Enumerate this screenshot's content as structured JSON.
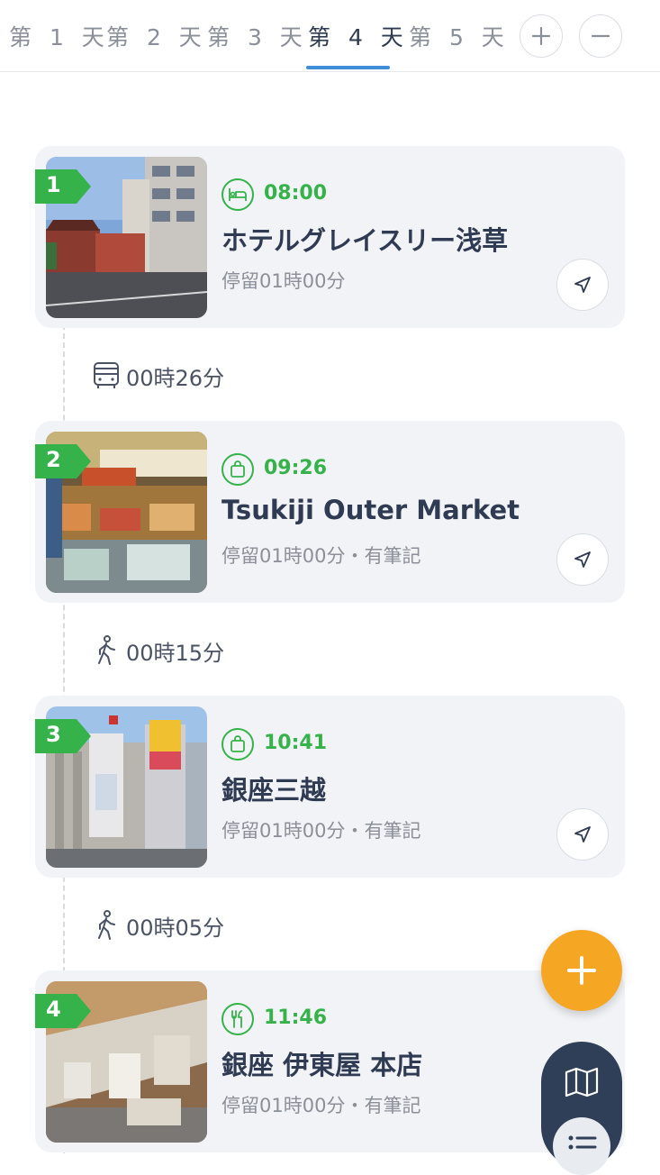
{
  "tabs": [
    {
      "label": "第 1 天",
      "active": false
    },
    {
      "label": "第 2 天",
      "active": false
    },
    {
      "label": "第 3 天",
      "active": false
    },
    {
      "label": "第 4 天",
      "active": true
    },
    {
      "label": "第 5 天",
      "active": false
    }
  ],
  "colors": {
    "accent_blue": "#3e8fd8",
    "badge_green": "#35b24a",
    "fab_orange": "#f5a623",
    "fab_dark": "#2f3f57"
  },
  "stops": [
    {
      "number": "1",
      "category_icon": "hotel-icon",
      "time": "08:00",
      "title": "ホテルグレイスリー浅草",
      "subtitle": "停留01時00分"
    },
    {
      "number": "2",
      "category_icon": "shopping-bag-icon",
      "time": "09:26",
      "title": "Tsukiji Outer Market",
      "subtitle": "停留01時00分・有筆記"
    },
    {
      "number": "3",
      "category_icon": "shopping-bag-icon",
      "time": "10:41",
      "title": "銀座三越",
      "subtitle": "停留01時00分・有筆記"
    },
    {
      "number": "4",
      "category_icon": "restaurant-icon",
      "time": "11:46",
      "title": "銀座 伊東屋 本店",
      "subtitle": "停留01時00分・有筆記"
    }
  ],
  "transits": [
    {
      "mode_icon": "bus-icon",
      "duration": "00時26分"
    },
    {
      "mode_icon": "walk-icon",
      "duration": "00時15分"
    },
    {
      "mode_icon": "walk-icon",
      "duration": "00時05分"
    }
  ]
}
